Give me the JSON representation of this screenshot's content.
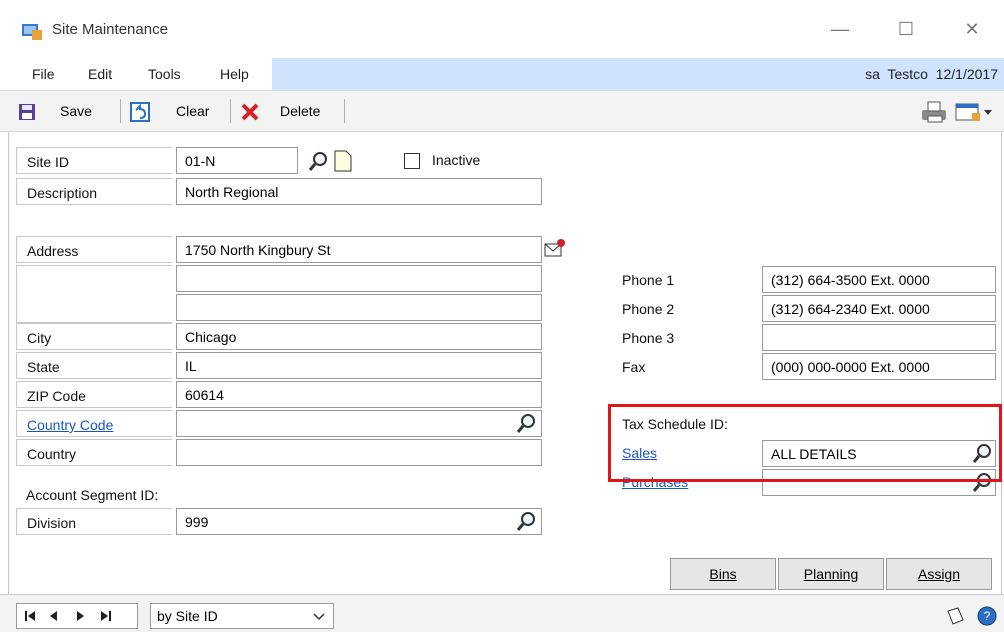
{
  "window": {
    "title": "Site Maintenance",
    "controls": {
      "minimize": "—",
      "maximize": "☐",
      "close": "✕"
    }
  },
  "menu": {
    "items": [
      "File",
      "Edit",
      "Tools",
      "Help"
    ],
    "user_info": "sa  Testco  12/1/2017"
  },
  "toolbar": {
    "save_label": "Save",
    "clear_label": "Clear",
    "delete_label": "Delete"
  },
  "form": {
    "site_id": {
      "label": "Site ID",
      "value": "01-N"
    },
    "inactive": {
      "label": "Inactive",
      "checked": false
    },
    "description": {
      "label": "Description",
      "value": "North Regional"
    },
    "address": {
      "label": "Address",
      "line1": "1750 North Kingbury St",
      "line2": "",
      "line3": ""
    },
    "city": {
      "label": "City",
      "value": "Chicago"
    },
    "state": {
      "label": "State",
      "value": "IL"
    },
    "zip": {
      "label": "ZIP Code",
      "value": "60614"
    },
    "country_code": {
      "label": "Country Code",
      "value": ""
    },
    "country": {
      "label": "Country",
      "value": ""
    },
    "account_segment": {
      "heading": "Account Segment ID:",
      "label": "Division",
      "value": "999"
    },
    "phone1": {
      "label": "Phone 1",
      "value": "(312) 664-3500  Ext. 0000"
    },
    "phone2": {
      "label": "Phone 2",
      "value": "(312) 664-2340  Ext. 0000"
    },
    "phone3": {
      "label": "Phone 3",
      "value": ""
    },
    "fax": {
      "label": "Fax",
      "value": "(000) 000-0000  Ext. 0000"
    },
    "tax_schedule": {
      "heading": "Tax Schedule ID:",
      "sales_label": "Sales",
      "sales_value": "ALL DETAILS",
      "purchases_label": "Purchases",
      "purchases_value": ""
    }
  },
  "buttons": {
    "bins": "Bins",
    "planning": "Planning",
    "assign": "Assign"
  },
  "statusbar": {
    "sort_value": "by Site ID"
  },
  "colors": {
    "highlight": "#e0161b",
    "link": "#1a55c8",
    "menu_accent": "#cfe3ff"
  }
}
